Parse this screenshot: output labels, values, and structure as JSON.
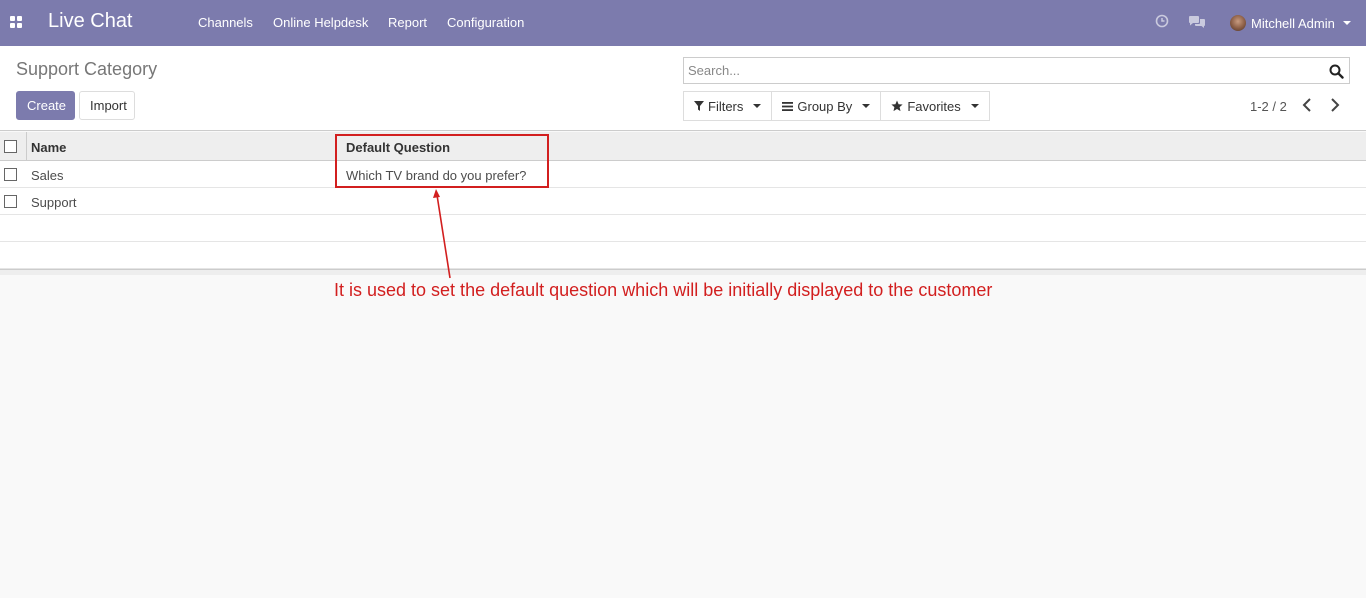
{
  "navbar": {
    "app_name": "Live Chat",
    "menu": [
      "Channels",
      "Online Helpdesk",
      "Report",
      "Configuration"
    ],
    "user_name": "Mitchell Admin",
    "icons": [
      "apps-icon",
      "clock-icon",
      "chat-icon",
      "avatar",
      "caret-down-icon"
    ],
    "bg_color": "#7c7bad"
  },
  "control_panel": {
    "title": "Support Category",
    "create_label": "Create",
    "import_label": "Import",
    "search_placeholder": "Search...",
    "filters_label": "Filters",
    "group_by_label": "Group By",
    "favorites_label": "Favorites",
    "pager_value": "1-2 / 2"
  },
  "table": {
    "columns": [
      "Name",
      "Default Question"
    ],
    "rows": [
      {
        "name": "Sales",
        "default_question": "Which TV brand do you prefer?"
      },
      {
        "name": "Support",
        "default_question": ""
      }
    ]
  },
  "annotation": {
    "text": "It is used to set the default question which will be initially displayed to the customer",
    "color": "#d21f1f"
  }
}
